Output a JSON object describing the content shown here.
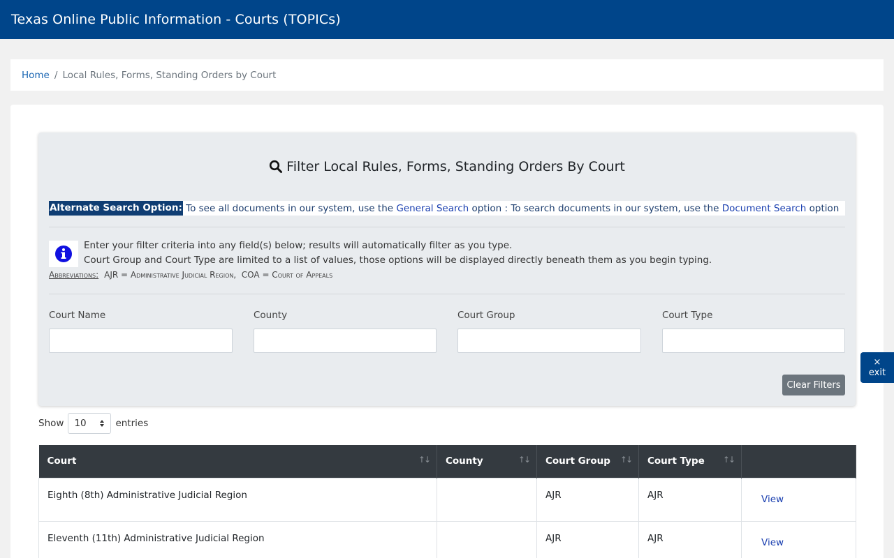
{
  "header": {
    "title": "Texas Online Public Information - Courts (TOPICs)"
  },
  "breadcrumb": {
    "home": "Home",
    "separator": "/",
    "current": "Local Rules, Forms, Standing Orders by Court"
  },
  "filter": {
    "title": "Filter Local Rules, Forms, Standing Orders By Court",
    "alt_label": "Alternate Search Option:",
    "alt_text_1": " To see all documents in our system, use the ",
    "alt_link_1": "General Search",
    "alt_text_2": " option : To search documents in our system, use the ",
    "alt_link_2": "Document Search",
    "alt_text_3": " option",
    "info_line_1": "Enter your filter criteria into any field(s) below; results will automatically filter as you type.",
    "info_line_2": "Court Group and Court Type are limited to a list of values, those options will be displayed directly beneath them as you begin typing.",
    "abbr_label": "Abbreviations:",
    "abbr_text": "AJR = Administrative Judicial Region,  COA = Court of Appeals",
    "fields": [
      {
        "label": "Court Name",
        "value": ""
      },
      {
        "label": "County",
        "value": ""
      },
      {
        "label": "Court Group",
        "value": ""
      },
      {
        "label": "Court Type",
        "value": ""
      }
    ],
    "clear_label": "Clear Filters"
  },
  "exit": {
    "icon": "×",
    "label": "exit"
  },
  "entries": {
    "show": "Show",
    "value": "10",
    "suffix": "entries"
  },
  "table": {
    "headers": [
      "Court",
      "County",
      "Court Group",
      "Court Type",
      ""
    ],
    "rows": [
      {
        "court": "Eighth (8th) Administrative Judicial Region",
        "county": "",
        "group": "AJR",
        "type": "AJR",
        "action": "View"
      },
      {
        "court": "Eleventh (11th) Administrative Judicial Region",
        "county": "",
        "group": "AJR",
        "type": "AJR",
        "action": "View"
      }
    ]
  }
}
